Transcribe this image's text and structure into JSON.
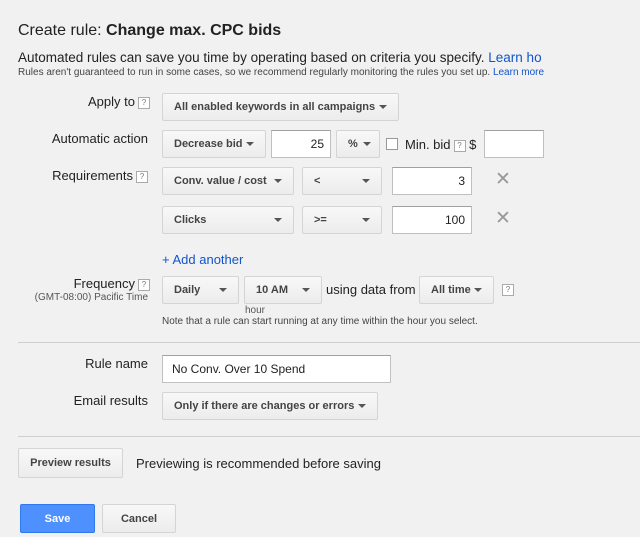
{
  "header": {
    "title_prefix": "Create rule: ",
    "title_name": "Change max. CPC bids",
    "description": "Automated rules can save you time by operating based on criteria you specify.",
    "learn_more_main": "Learn ho",
    "note": "Rules aren't guaranteed to run in some cases, so we recommend regularly monitoring the rules you set up.",
    "learn_more": "Learn more"
  },
  "apply_to": {
    "label": "Apply to",
    "value": "All enabled keywords in all campaigns"
  },
  "automatic_action": {
    "label": "Automatic action",
    "action": "Decrease bid",
    "amount": "25",
    "unit": "%",
    "min_bid_label": "Min. bid",
    "currency": "$",
    "min_bid_value": ""
  },
  "requirements": {
    "label": "Requirements",
    "rows": [
      {
        "metric": "Conv. value / cost",
        "operator": "<",
        "value": "3"
      },
      {
        "metric": "Clicks",
        "operator": ">=",
        "value": "100"
      }
    ],
    "add_another": "+ Add another"
  },
  "frequency": {
    "label": "Frequency",
    "timezone": "(GMT-08:00) Pacific Time",
    "period": "Daily",
    "time": "10 AM",
    "hour_caption": "hour",
    "using_text": "using data from",
    "data_range": "All time",
    "note": "Note that a rule can start running at any time within the hour you select."
  },
  "rule_name": {
    "label": "Rule name",
    "value": "No Conv. Over 10 Spend"
  },
  "email_results": {
    "label": "Email results",
    "value": "Only if there are changes or errors"
  },
  "preview": {
    "button": "Preview results",
    "text": "Previewing is recommended before saving"
  },
  "footer": {
    "save": "Save",
    "cancel": "Cancel"
  },
  "help_glyph": "?",
  "remove_glyph": "✕",
  "colors": {
    "link": "#1155cc",
    "primary": "#4d90fe",
    "background": "#f1f1f1"
  }
}
